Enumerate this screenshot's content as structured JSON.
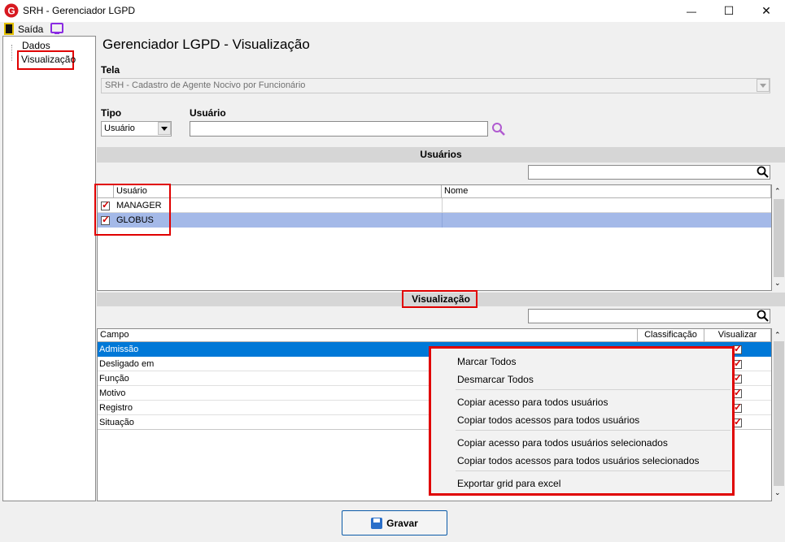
{
  "window": {
    "title": "SRH - Gerenciador LGPD",
    "logo_letter": "G",
    "minimize": "—",
    "maximize": "☐",
    "close": "✕"
  },
  "toolbar": {
    "exit_label": "Saída"
  },
  "tree": {
    "items": [
      {
        "label": "Dados"
      },
      {
        "label": "Visualização"
      }
    ]
  },
  "page_title": "Gerenciador LGPD - Visualização",
  "tela": {
    "label": "Tela",
    "value": "SRH - Cadastro de Agente Nocivo por Funcionário"
  },
  "tipo": {
    "label": "Tipo",
    "value": "Usuário"
  },
  "usuario": {
    "label": "Usuário",
    "value": ""
  },
  "users_section": {
    "title": "Usuários",
    "columns": [
      "Usuário",
      "Nome"
    ],
    "rows": [
      {
        "checked": true,
        "user": "MANAGER",
        "name": ""
      },
      {
        "checked": true,
        "user": "GLOBUS",
        "name": ""
      }
    ]
  },
  "view_section": {
    "title": "Visualização",
    "columns": [
      "Campo",
      "Classificação",
      "Visualizar"
    ],
    "rows": [
      {
        "field": "Admissão",
        "checked": true
      },
      {
        "field": "Desligado em",
        "checked": true
      },
      {
        "field": "Função",
        "checked": true
      },
      {
        "field": "Motivo",
        "checked": true
      },
      {
        "field": "Registro",
        "checked": true
      },
      {
        "field": "Situação",
        "checked": true
      }
    ]
  },
  "context_menu": {
    "items": [
      "Marcar Todos",
      "Desmarcar Todos",
      "Copiar acesso para todos usuários",
      "Copiar todos acessos para todos usuários",
      "Copiar acesso para todos usuários selecionados",
      "Copiar todos acessos para todos usuários selecionados",
      "Exportar grid para excel"
    ]
  },
  "save_button": {
    "label": "Gravar"
  },
  "colors": {
    "selection_blue": "#0078d7",
    "row_highlight": "#a4b9e8",
    "annotation_red": "#e00000"
  }
}
